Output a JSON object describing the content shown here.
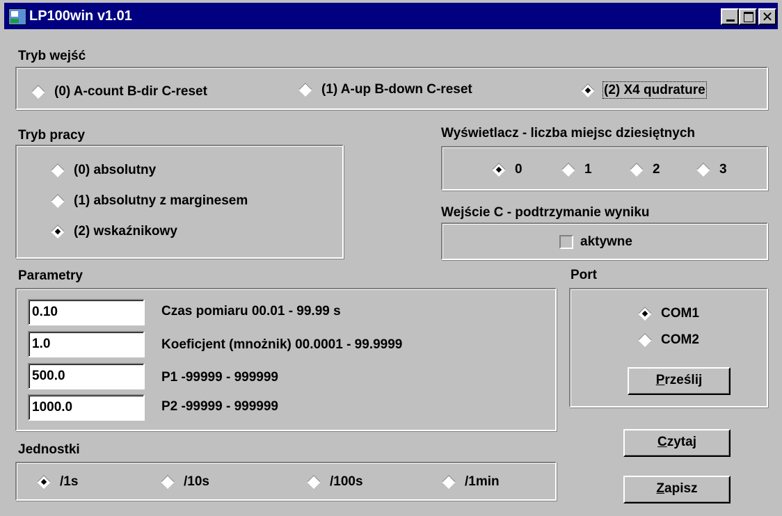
{
  "window": {
    "title": "LP100win v1.01"
  },
  "tryb_wejsc": {
    "title": "Tryb wejść",
    "options": [
      {
        "label": "(0)  A-count B-dir C-reset",
        "selected": false
      },
      {
        "label": "(1) A-up B-down C-reset",
        "selected": false
      },
      {
        "label": "(2) X4 qudrature",
        "selected": true
      }
    ]
  },
  "tryb_pracy": {
    "title": "Tryb pracy",
    "options": [
      {
        "label": "(0) absolutny",
        "selected": false
      },
      {
        "label": "(1) absolutny z marginesem",
        "selected": false
      },
      {
        "label": "(2) wskaźnikowy",
        "selected": true
      }
    ]
  },
  "wyswietlacz": {
    "title": "Wyświetlacz - liczba miejsc dziesiętnych",
    "options": [
      {
        "label": "0",
        "selected": true
      },
      {
        "label": "1",
        "selected": false
      },
      {
        "label": "2",
        "selected": false
      },
      {
        "label": "3",
        "selected": false
      }
    ]
  },
  "wejscie_c": {
    "title": "Wejście C - podtrzymanie wyniku",
    "checkbox_label": "aktywne",
    "checked": false
  },
  "parametry": {
    "title": "Parametry",
    "rows": [
      {
        "value": "0.10",
        "label": "Czas pomiaru 00.01 - 99.99 s"
      },
      {
        "value": "1.0",
        "label": "Koeficjent (mnożnik) 00.0001 - 99.9999"
      },
      {
        "value": "500.0",
        "label": "P1  -99999 - 999999"
      },
      {
        "value": "1000.0",
        "label": "P2  -99999 - 999999"
      }
    ]
  },
  "port": {
    "title": "Port",
    "options": [
      {
        "label": "COM1",
        "selected": true
      },
      {
        "label": "COM2",
        "selected": false
      }
    ],
    "send_accel": "P",
    "send_rest": "rześlij"
  },
  "jednostki": {
    "title": "Jednostki",
    "options": [
      {
        "label": "/1s",
        "selected": true
      },
      {
        "label": "/10s",
        "selected": false
      },
      {
        "label": "/100s",
        "selected": false
      },
      {
        "label": "/1min",
        "selected": false
      }
    ]
  },
  "buttons": {
    "read_accel": "C",
    "read_rest": "zytaj",
    "save_accel": "Z",
    "save_rest": "apisz"
  }
}
